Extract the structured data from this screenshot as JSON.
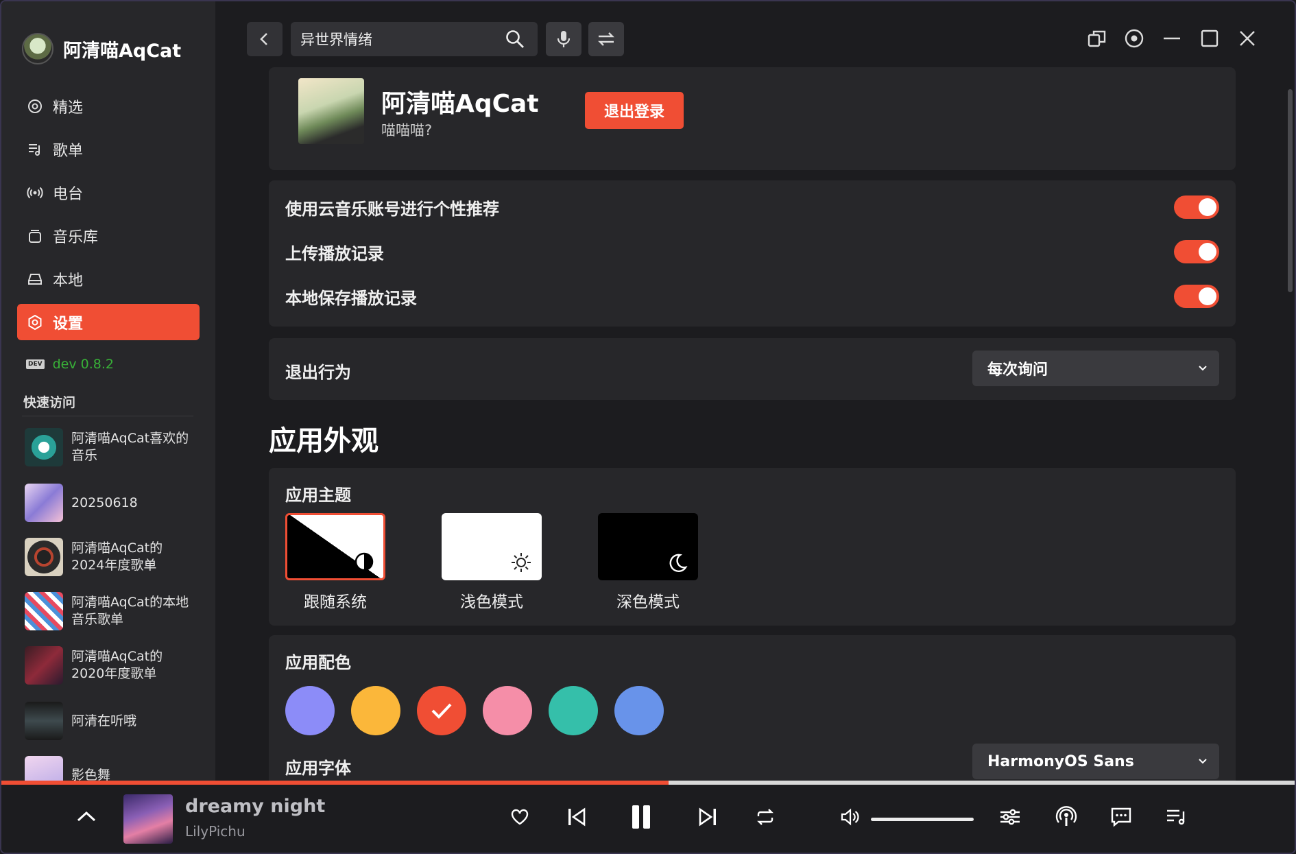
{
  "app": {
    "brand_name": "阿清喵AqCat"
  },
  "nav": {
    "items": [
      {
        "label": "精选",
        "icon": "compass-icon"
      },
      {
        "label": "歌单",
        "icon": "playlist-icon"
      },
      {
        "label": "电台",
        "icon": "radio-icon"
      },
      {
        "label": "音乐库",
        "icon": "library-icon"
      },
      {
        "label": "本地",
        "icon": "drive-icon"
      },
      {
        "label": "设置",
        "icon": "gear-icon",
        "active": true
      }
    ]
  },
  "version": {
    "badge": "DEV",
    "text": "dev 0.8.2"
  },
  "quick_access": {
    "title": "快速访问",
    "items": [
      {
        "name": "阿清喵AqCat喜欢的音乐"
      },
      {
        "name": "20250618"
      },
      {
        "name": "阿清喵AqCat的2024年度歌单"
      },
      {
        "name": "阿清喵AqCat的本地音乐歌单"
      },
      {
        "name": "阿清喵AqCat的2020年度歌单"
      },
      {
        "name": "阿清在听哦"
      },
      {
        "name": "影色舞"
      }
    ]
  },
  "search": {
    "value": "异世界情绪"
  },
  "profile": {
    "name": "阿清喵AqCat",
    "subtitle": "喵喵喵?",
    "logout_label": "退出登录"
  },
  "toggles": [
    {
      "label": "使用云音乐账号进行个性推荐",
      "on": true
    },
    {
      "label": "上传播放记录",
      "on": true
    },
    {
      "label": "本地保存播放记录",
      "on": true
    }
  ],
  "exit_behavior": {
    "label": "退出行为",
    "value": "每次询问"
  },
  "appearance": {
    "section_title": "应用外观",
    "theme": {
      "title": "应用主题",
      "options": [
        {
          "label": "跟随系统",
          "selected": true
        },
        {
          "label": "浅色模式",
          "selected": false
        },
        {
          "label": "深色模式",
          "selected": false
        }
      ]
    },
    "accent": {
      "title": "应用配色",
      "colors": [
        "#8c8cf8",
        "#fbb73a",
        "#f04e34",
        "#f58ea8",
        "#35bfaa",
        "#6893ea"
      ],
      "selected_index": 2
    },
    "font": {
      "title": "应用字体",
      "value": "HarmonyOS Sans"
    }
  },
  "player": {
    "song_title": "dreamy night",
    "artist": "LilyPichu",
    "progress": 0.515,
    "volume": 1.0
  },
  "colors": {
    "accent": "#f04e34",
    "background": "#1c1c1f",
    "card": "#27272a"
  }
}
